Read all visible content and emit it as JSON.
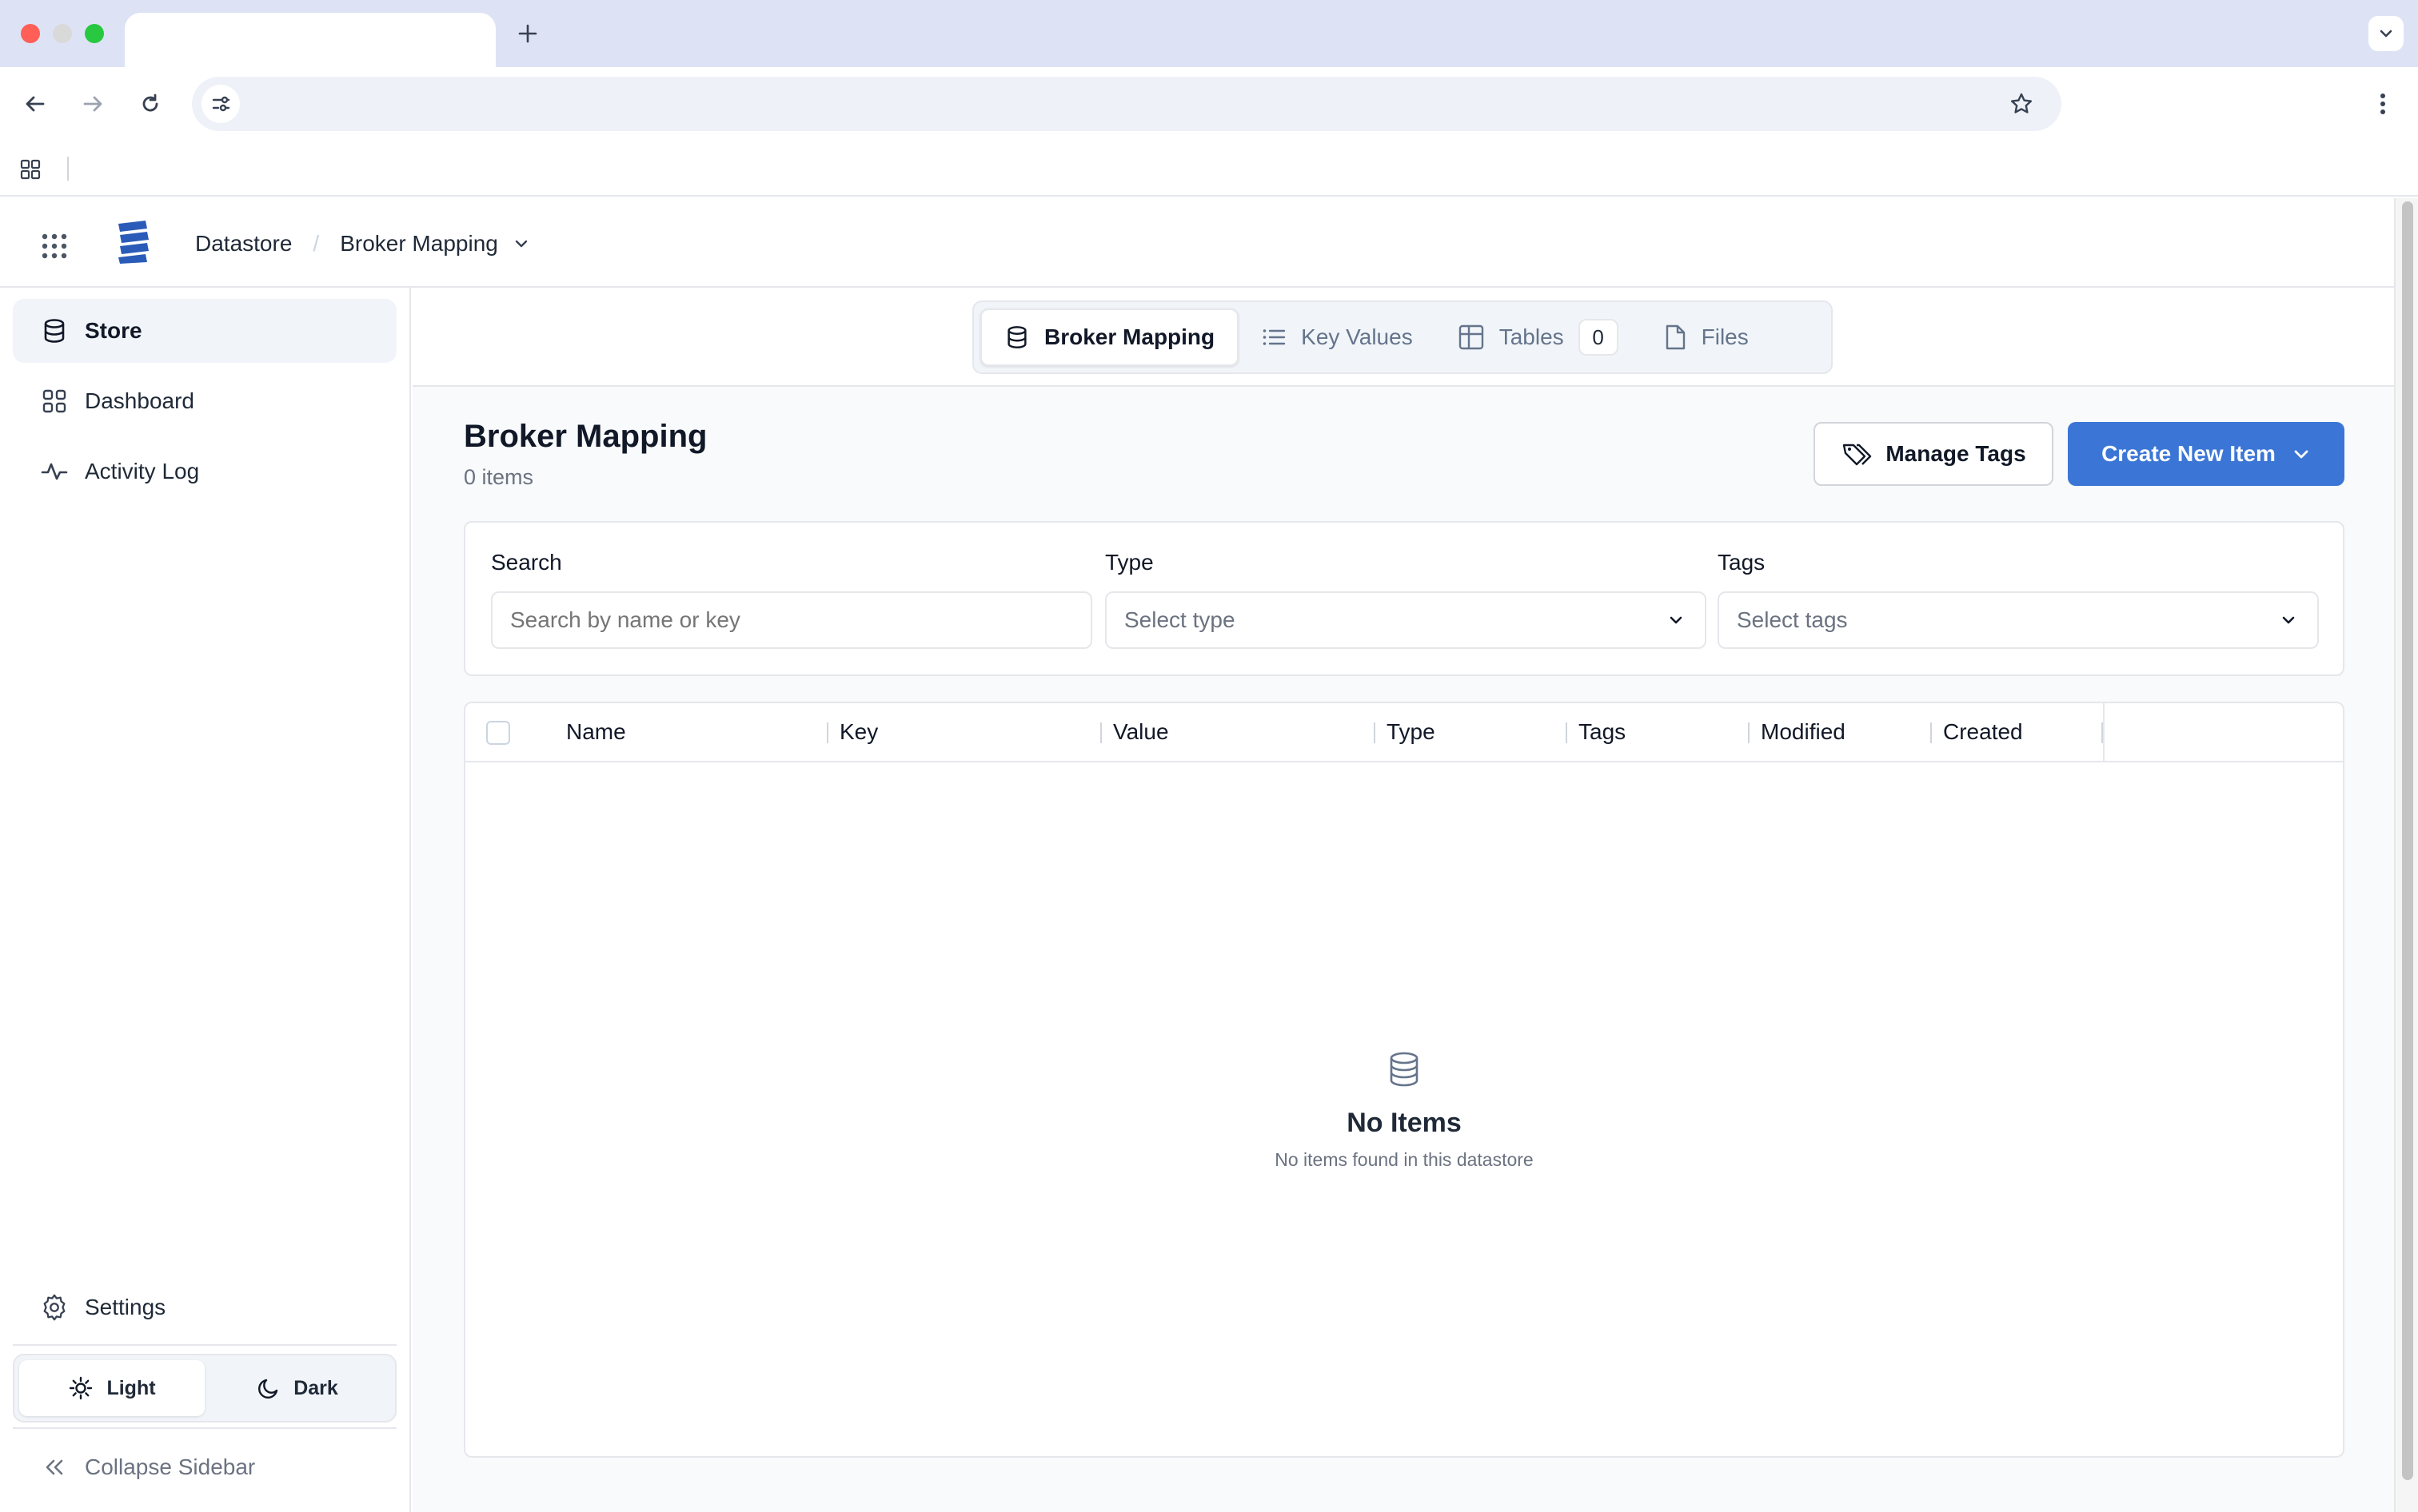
{
  "app": {
    "breadcrumb": {
      "root": "Datastore",
      "separator": "/",
      "current": "Broker Mapping"
    }
  },
  "sidebar": {
    "items": [
      {
        "label": "Store",
        "icon": "database-icon",
        "active": true
      },
      {
        "label": "Dashboard",
        "icon": "dashboard-grid-icon",
        "active": false
      },
      {
        "label": "Activity Log",
        "icon": "activity-pulse-icon",
        "active": false
      }
    ],
    "settings_label": "Settings",
    "theme": {
      "light_label": "Light",
      "dark_label": "Dark",
      "selected": "Light"
    },
    "collapse_label": "Collapse Sidebar"
  },
  "tabs": [
    {
      "label": "Broker Mapping",
      "icon": "database-icon",
      "active": true
    },
    {
      "label": "Key Values",
      "icon": "list-icon",
      "active": false
    },
    {
      "label": "Tables",
      "icon": "table-icon",
      "count": "0",
      "active": false
    },
    {
      "label": "Files",
      "icon": "file-icon",
      "active": false
    }
  ],
  "page": {
    "title": "Broker Mapping",
    "item_count": "0 items",
    "manage_tags_label": "Manage Tags",
    "create_label": "Create New Item"
  },
  "filters": {
    "search": {
      "label": "Search",
      "placeholder": "Search by name or key",
      "value": ""
    },
    "type": {
      "label": "Type",
      "placeholder": "Select type"
    },
    "tags": {
      "label": "Tags",
      "placeholder": "Select tags"
    }
  },
  "table": {
    "columns": [
      "Name",
      "Key",
      "Value",
      "Type",
      "Tags",
      "Modified",
      "Created"
    ],
    "rows": [],
    "empty_title": "No Items",
    "empty_subtitle": "No items found in this datastore"
  },
  "colors": {
    "primary": "#3b76d6",
    "tabstrip": "#dde3f5",
    "sidebar_active": "#f1f5f9"
  }
}
